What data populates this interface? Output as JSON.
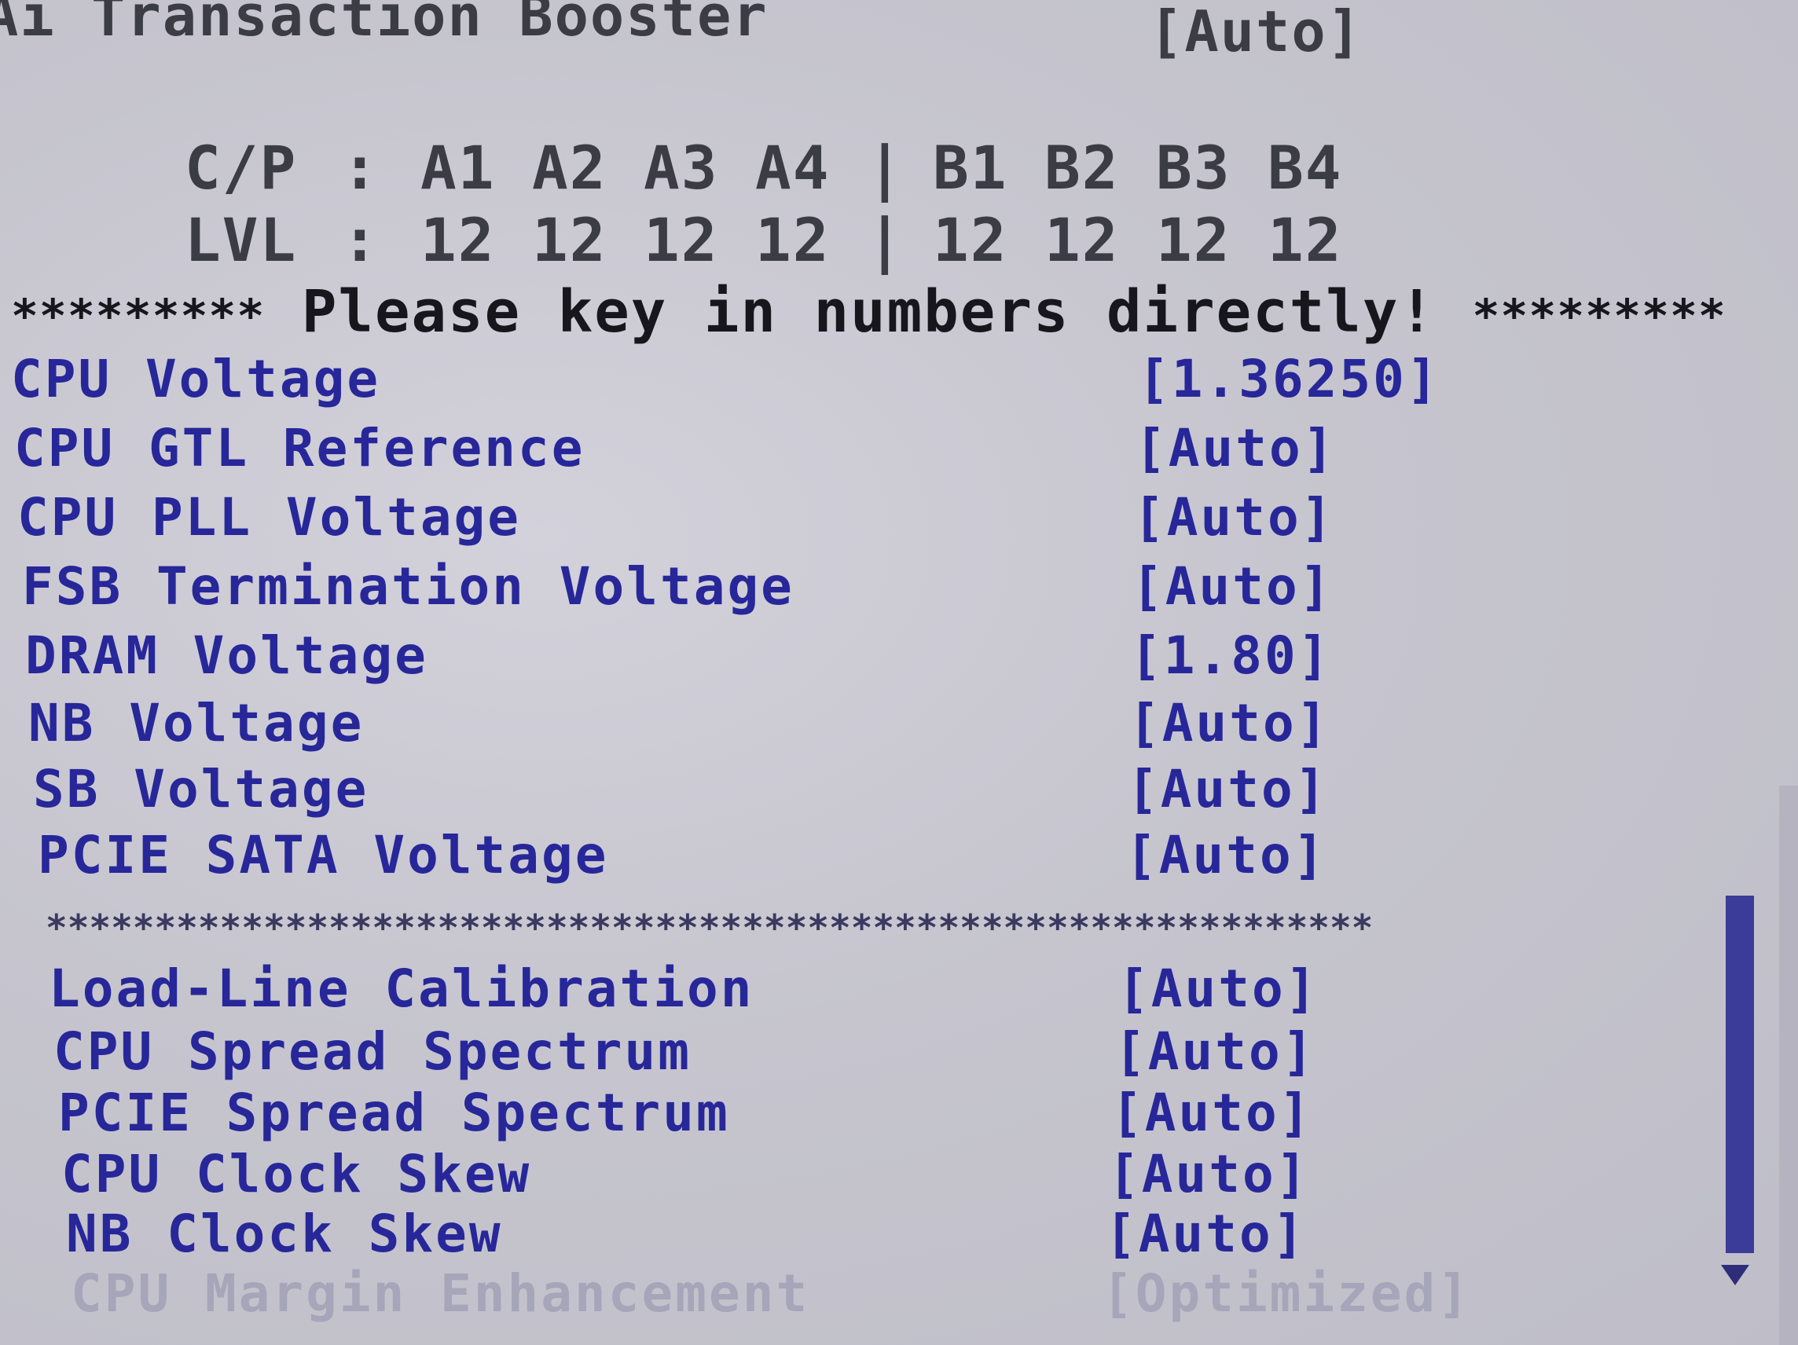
{
  "header": {
    "title": "Ai Transaction Booster",
    "value": "[Auto]"
  },
  "channel_table": {
    "cp_label": "C/P",
    "lvl_label": "LVL",
    "colon": ":",
    "separator": "|",
    "a_channels": [
      "A1",
      "A2",
      "A3",
      "A4"
    ],
    "b_channels": [
      "B1",
      "B2",
      "B3",
      "B4"
    ],
    "a_levels": [
      "12",
      "12",
      "12",
      "12"
    ],
    "b_levels": [
      "12",
      "12",
      "12",
      "12"
    ]
  },
  "notice": {
    "stars_left": "*********",
    "text": "Please key in numbers directly!",
    "stars_right": "*********"
  },
  "voltage_items": [
    {
      "label": "CPU Voltage",
      "value": "[1.36250]"
    },
    {
      "label": "CPU GTL Reference",
      "value": "[Auto]"
    },
    {
      "label": "CPU PLL Voltage",
      "value": "[Auto]"
    },
    {
      "label": "FSB Termination Voltage",
      "value": "[Auto]"
    },
    {
      "label": "DRAM Voltage",
      "value": "[1.80]"
    },
    {
      "label": "NB Voltage",
      "value": "[Auto]"
    },
    {
      "label": "SB Voltage",
      "value": "[Auto]"
    },
    {
      "label": "PCIE SATA Voltage",
      "value": "[Auto]"
    }
  ],
  "divider": "*************************************************************",
  "other_items": [
    {
      "label": "Load-Line Calibration",
      "value": "[Auto]"
    },
    {
      "label": "CPU Spread Spectrum",
      "value": "[Auto]"
    },
    {
      "label": "PCIE Spread Spectrum",
      "value": "[Auto]"
    },
    {
      "label": "CPU Clock Skew",
      "value": "[Auto]"
    },
    {
      "label": "NB Clock Skew",
      "value": "[Auto]"
    },
    {
      "label": "CPU Margin Enhancement",
      "value": "[Optimized]"
    }
  ],
  "colors": {
    "background": "#c7c6cf",
    "item_text": "#27279a",
    "disabled_text": "#a6a5b9",
    "header_text": "#3c3c44",
    "scrollbar": "#3b3b9a"
  },
  "icons": {
    "scroll_down": "down-arrow-icon"
  }
}
